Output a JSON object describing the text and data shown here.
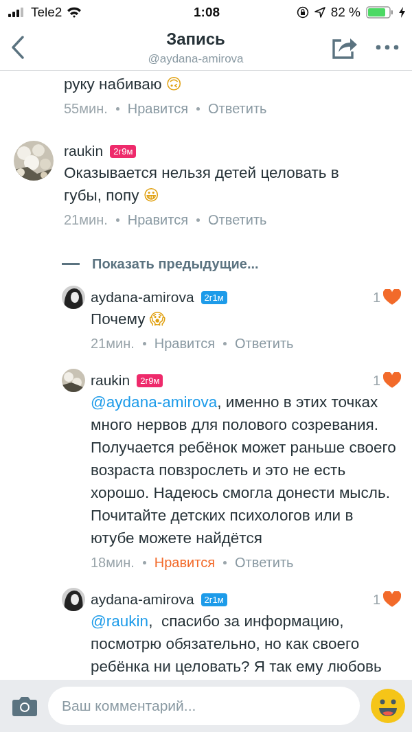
{
  "status_bar": {
    "carrier": "Tele2",
    "time": "1:08",
    "battery": "82 %"
  },
  "header": {
    "title": "Запись",
    "subtitle": "@aydana-amirova"
  },
  "comments": [
    {
      "partial": true,
      "text": "руку набиваю",
      "emoji": "🙃",
      "time": "55мин.",
      "like": "Нравится",
      "liked": false,
      "reply": "Ответить"
    },
    {
      "partial": false,
      "author": "raukin",
      "badge": "2г9м",
      "color": "#ee2a6b",
      "text": "Оказывается нельзя детей целовать в губы, попу",
      "emoji": "😀",
      "time": "21мин.",
      "like": "Нравится",
      "liked": false,
      "reply": "Ответить"
    }
  ],
  "show_previous": "Показать предыдущие...",
  "replies": [
    {
      "author": "aydana-amirova",
      "badge": "2г1м",
      "color": "#1d9be9",
      "likes": "1",
      "text": "Почему",
      "emoji": "😱",
      "time": "21мин.",
      "like": "Нравится",
      "liked": false,
      "reply": "Ответить"
    },
    {
      "author": "raukin",
      "badge": "2г9м",
      "color": "#ee2a6b",
      "likes": "1",
      "mention": "@aydana-amirova",
      "text": ", именно в этих точках много нервов для полового созревания. Получается ребёнок может раньше своего возраста повзрослеть и это не есть хорошо. Надеюсь смогла донести мысль. Почитайте детских психологов или в ютубе можете найдётся",
      "time": "18мин.",
      "like": "Нравится",
      "liked": true,
      "reply": "Ответить"
    },
    {
      "author": "aydana-amirova",
      "badge": "2г1м",
      "color": "#1d9be9",
      "likes": "1",
      "mention": "@raukin",
      "text": ",  спасибо за информацию, посмотрю обязательно, но как своего ребёнка ни целовать? Я так ему любовь"
    }
  ],
  "composer": {
    "placeholder": "Ваш комментарий..."
  }
}
